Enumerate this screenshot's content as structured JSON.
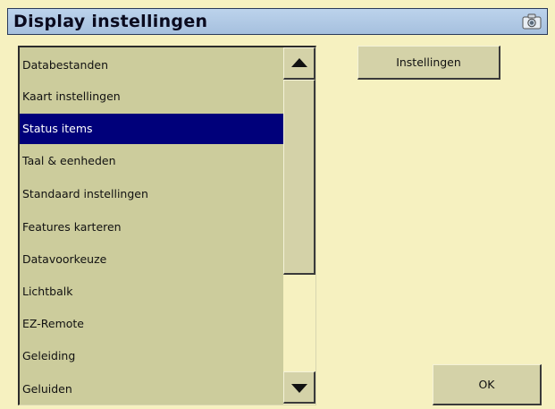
{
  "window": {
    "title": "Display instellingen"
  },
  "list": {
    "items": [
      {
        "label": "Databestanden",
        "selected": false
      },
      {
        "label": "Kaart instellingen",
        "selected": false
      },
      {
        "label": "Status items",
        "selected": true
      },
      {
        "label": "Taal & eenheden",
        "selected": false
      },
      {
        "label": "Standaard instellingen",
        "selected": false
      },
      {
        "label": "Features karteren",
        "selected": false
      },
      {
        "label": "Datavoorkeuze",
        "selected": false
      },
      {
        "label": "Lichtbalk",
        "selected": false
      },
      {
        "label": "EZ-Remote",
        "selected": false
      },
      {
        "label": "Geleiding",
        "selected": false
      },
      {
        "label": "Geluiden",
        "selected": false
      }
    ]
  },
  "buttons": {
    "settings_label": "Instellingen",
    "ok_label": "OK"
  },
  "icons": {
    "title_icon": "camera-icon",
    "scroll_up": "arrow-up-icon",
    "scroll_down": "arrow-down-icon"
  },
  "colors": {
    "background": "#f6f1c0",
    "list_background": "#cccc9c",
    "selection": "#00007a",
    "titlebar": "#b2c9e6"
  }
}
